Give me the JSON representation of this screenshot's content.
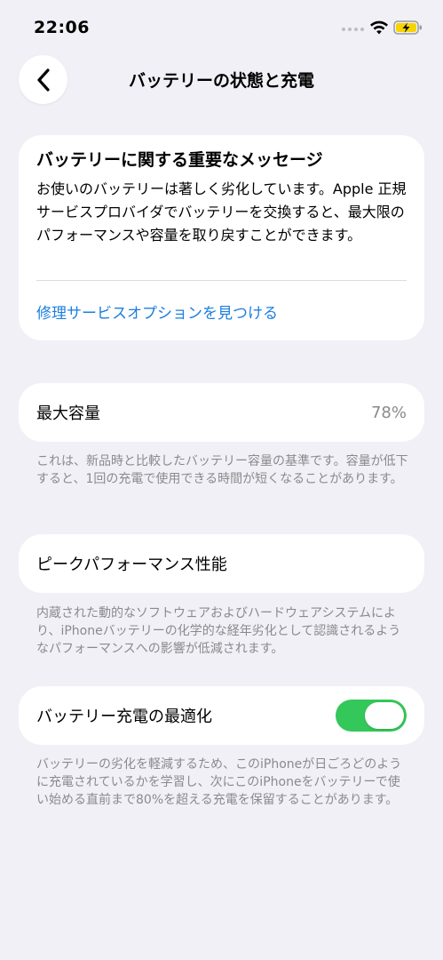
{
  "status_bar": {
    "time": "22:06",
    "icons": [
      "signal-dots-icon",
      "wifi-icon",
      "battery-charging-icon"
    ]
  },
  "nav": {
    "back_icon": "chevron-left-icon",
    "title": "バッテリーの状態と充電"
  },
  "important_message": {
    "title": "バッテリーに関する重要なメッセージ",
    "body": "お使いのバッテリーは著しく劣化しています。Apple 正規サービスプロバイダでバッテリーを交換すると、最大限のパフォーマンスや容量を取り戻すことができます。",
    "link": "修理サービスオプションを見つける"
  },
  "max_capacity": {
    "label": "最大容量",
    "value": "78%",
    "footnote": "これは、新品時と比較したバッテリー容量の基準です。容量が低下すると、1回の充電で使用できる時間が短くなることがあります。"
  },
  "peak_performance": {
    "label": "ピークパフォーマンス性能",
    "footnote": "内蔵された動的なソフトウェアおよびハードウェアシステムにより、iPhoneバッテリーの化学的な経年劣化として認識されるようなパフォーマンスへの影響が低減されます。"
  },
  "charging_optimization": {
    "label": "バッテリー充電の最適化",
    "toggle_on": true,
    "footnote": "バッテリーの劣化を軽減するため、このiPhoneが日ごろどのように充電されているかを学習し、次にこのiPhoneをバッテリーで使い始める直前まで80%を超える充電を保留することがあります。"
  },
  "colors": {
    "background": "#F1F0F6",
    "card": "#FFFFFF",
    "link": "#1C7EE0",
    "toggle_on": "#34C759",
    "secondary_text": "#8A8A8E",
    "battery_fill": "#F5D400"
  }
}
